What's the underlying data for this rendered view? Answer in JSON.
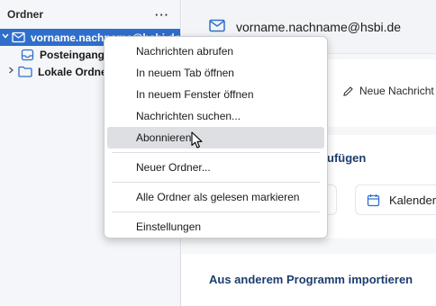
{
  "sidebar": {
    "title": "Ordner",
    "more_label": "···",
    "account_label": "vorname.nachname@hsbi.de",
    "inbox_label": "Posteingang",
    "local_folders_label": "Lokale Ordner"
  },
  "main": {
    "account_email": "vorname.nachname@hsbi.de",
    "new_message_label": "Neue Nachricht",
    "section_add_label": "ufügen",
    "calendar_label": "Kalender",
    "section_import_label": "Aus anderem Programm importieren"
  },
  "context_menu": {
    "get_messages": "Nachrichten abrufen",
    "open_new_tab": "In neuem Tab öffnen",
    "open_new_window": "In neuem Fenster öffnen",
    "search_messages": "Nachrichten suchen...",
    "subscribe": "Abonnieren...",
    "new_folder": "Neuer Ordner...",
    "mark_all_read": "Alle Ordner als gelesen markieren",
    "settings": "Einstellungen"
  },
  "colors": {
    "accent": "#2f6fcb",
    "sidebar_bg": "#f4f6f9",
    "heading": "#1d3c6e"
  },
  "icons": [
    "more-icon",
    "chevron-down-icon",
    "chevron-right-icon",
    "mail-account-icon",
    "inbox-icon",
    "folder-icon",
    "pencil-icon",
    "calendar-icon",
    "mouse-cursor-icon"
  ]
}
